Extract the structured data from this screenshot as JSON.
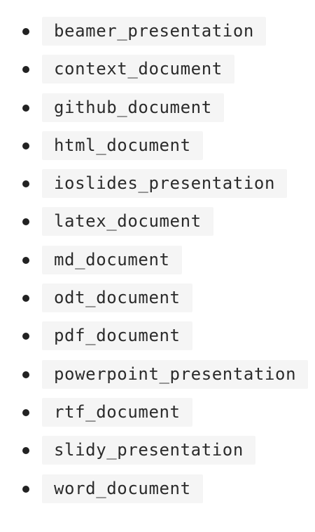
{
  "items": [
    {
      "label": "beamer_presentation"
    },
    {
      "label": "context_document"
    },
    {
      "label": "github_document"
    },
    {
      "label": "html_document"
    },
    {
      "label": "ioslides_presentation"
    },
    {
      "label": "latex_document"
    },
    {
      "label": "md_document"
    },
    {
      "label": "odt_document"
    },
    {
      "label": "pdf_document"
    },
    {
      "label": "powerpoint_presentation"
    },
    {
      "label": "rtf_document"
    },
    {
      "label": "slidy_presentation"
    },
    {
      "label": "word_document"
    }
  ],
  "colors": {
    "code_background": "#f5f5f5",
    "text": "#2b2b2b",
    "bullet": "#222222"
  }
}
